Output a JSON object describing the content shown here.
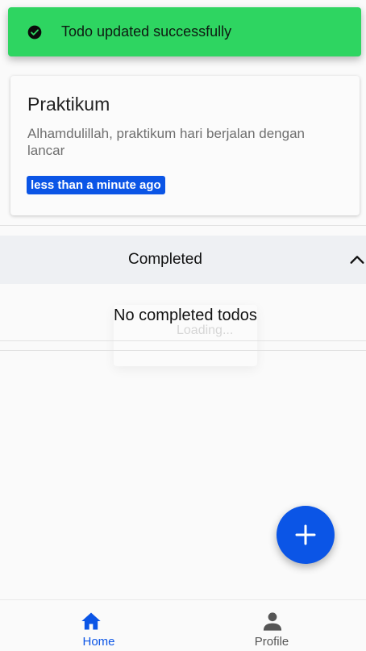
{
  "toast": {
    "icon": "check-circle-icon",
    "message": "Todo updated successfully",
    "color": "#2ed561"
  },
  "todo": {
    "title": "Praktikum",
    "description": "Alhamdulillah, praktikum hari berjalan dengan lancar",
    "time_badge": "less than a minute ago",
    "badge_color": "#0b55e6"
  },
  "completed": {
    "title": "Completed",
    "expanded": true,
    "toggle_icon": "chevron-up-icon",
    "empty_message": "No completed todos"
  },
  "loading": {
    "text": "Loading..."
  },
  "fab": {
    "icon": "plus-icon",
    "color": "#0b55e6"
  },
  "bottom_nav": {
    "items": [
      {
        "label": "Home",
        "icon": "home-icon",
        "active": true,
        "color": "#0b55e6"
      },
      {
        "label": "Profile",
        "icon": "person-icon",
        "active": false,
        "color": "#555555"
      }
    ]
  }
}
